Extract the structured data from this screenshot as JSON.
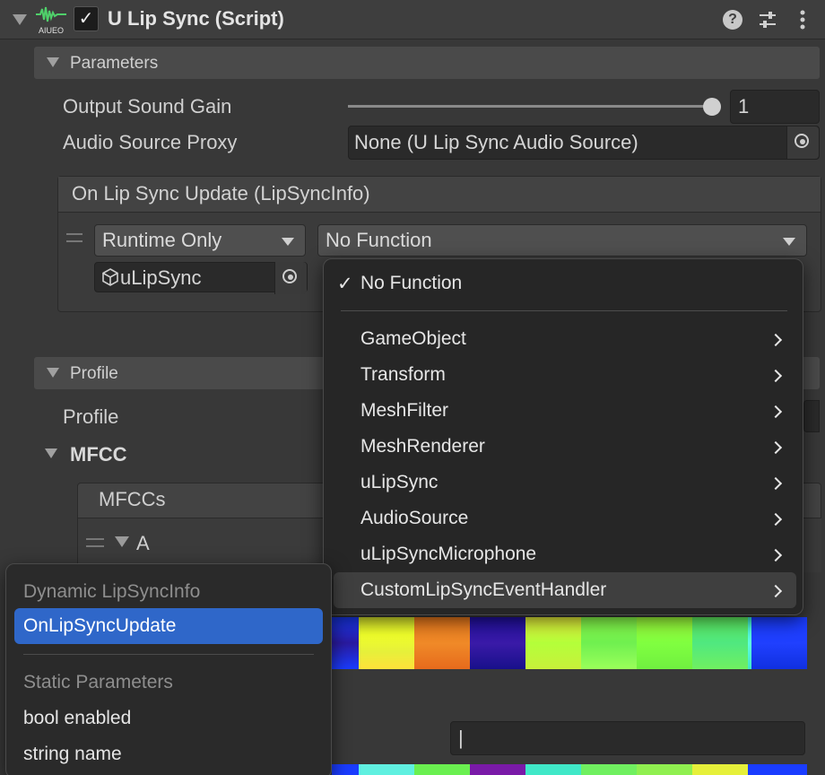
{
  "header": {
    "script_icon_label": "AIUEO",
    "enabled_mark": "✓",
    "title": "U Lip Sync (Script)",
    "help_glyph": "?"
  },
  "parameters": {
    "section_label": "Parameters",
    "output_gain_label": "Output Sound Gain",
    "output_gain_value": "1",
    "output_gain_slider_fraction": 1.0,
    "audio_proxy_label": "Audio Source Proxy",
    "audio_proxy_value": "None (U Lip Sync Audio Source)"
  },
  "event": {
    "title": "On Lip Sync Update (LipSyncInfo)",
    "runtime_mode": "Runtime Only",
    "function": "No Function",
    "target_object": "uLipSync"
  },
  "profile": {
    "section_label": "Profile",
    "profile_label": "Profile",
    "mfcc_label": "MFCC",
    "mfccs_label": "MFCCs",
    "phoneme_a": "A",
    "text_value": "|"
  },
  "function_menu": {
    "checked_mark": "✓",
    "checked_item": "No Function",
    "items": [
      "GameObject",
      "Transform",
      "MeshFilter",
      "MeshRenderer",
      "uLipSync",
      "AudioSource",
      "uLipSyncMicrophone",
      "CustomLipSyncEventHandler"
    ]
  },
  "method_menu": {
    "dynamic_header": "Dynamic LipSyncInfo",
    "dynamic_selected": "OnLipSyncUpdate",
    "static_header": "Static Parameters",
    "static_items": [
      "bool enabled",
      "string name"
    ]
  },
  "colors": {
    "background": "#383838",
    "selection": "#2f67c9",
    "popup": "#262626"
  }
}
